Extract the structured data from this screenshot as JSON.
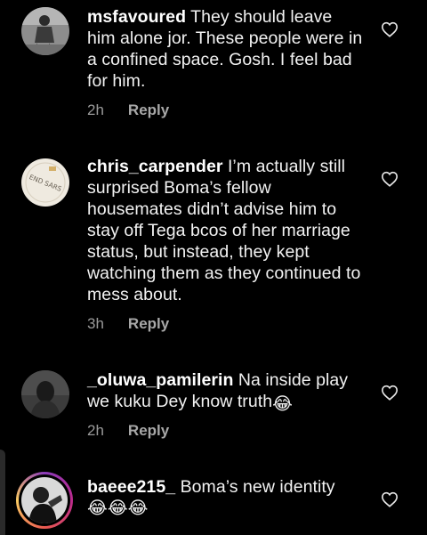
{
  "comments": [
    {
      "username": "msfavoured",
      "text": "They should leave him alone jor. These people were in a confined space. Gosh. I feel bad for him.",
      "time": "2h",
      "reply_label": "Reply",
      "avatar": "user-avatar-icon"
    },
    {
      "username": "chris_carpender",
      "text": "I’m actually still surprised Boma’s fellow housemates didn’t advise him to stay off Tega bcos of her marriage status, but instead, they kept watching them as they continued to mess about.",
      "time": "3h",
      "reply_label": "Reply",
      "avatar": "end-sars-badge-avatar",
      "avatar_text": "END SARS"
    },
    {
      "username": "_oluwa_pamilerin",
      "text": "Na inside play we kuku Dey know truth",
      "emoji": "😂",
      "time": "2h",
      "reply_label": "Reply",
      "avatar": "user-avatar-icon"
    },
    {
      "username": "baeee215_",
      "text": "Boma’s new identity",
      "emoji_line": "😂😂😂",
      "avatar": "user-avatar-icon"
    }
  ],
  "icons": {
    "like": "heart-outline-icon"
  },
  "colors": {
    "background": "#000000",
    "text": "#f2f2f2",
    "meta": "#9a9a9a",
    "story_ring": "#bc2a8d"
  }
}
